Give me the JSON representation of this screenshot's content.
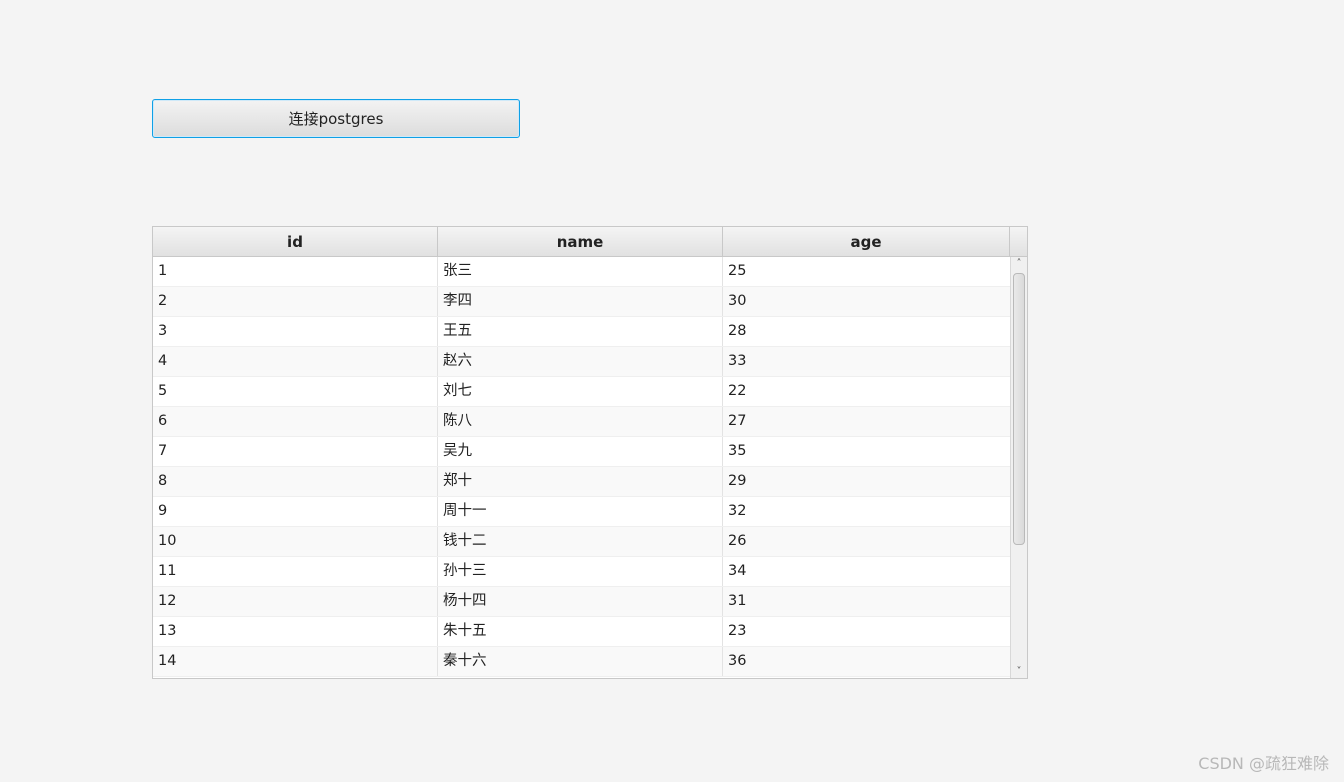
{
  "toolbar": {
    "connect_label": "连接postgres"
  },
  "table": {
    "columns": [
      "id",
      "name",
      "age"
    ],
    "rows": [
      [
        "1",
        "张三",
        "25"
      ],
      [
        "2",
        "李四",
        "30"
      ],
      [
        "3",
        "王五",
        "28"
      ],
      [
        "4",
        "赵六",
        "33"
      ],
      [
        "5",
        "刘七",
        "22"
      ],
      [
        "6",
        "陈八",
        "27"
      ],
      [
        "7",
        "吴九",
        "35"
      ],
      [
        "8",
        "郑十",
        "29"
      ],
      [
        "9",
        "周十一",
        "32"
      ],
      [
        "10",
        "钱十二",
        "26"
      ],
      [
        "11",
        "孙十三",
        "34"
      ],
      [
        "12",
        "杨十四",
        "31"
      ],
      [
        "13",
        "朱十五",
        "23"
      ],
      [
        "14",
        "秦十六",
        "36"
      ]
    ]
  },
  "scrollbar": {
    "up_icon": "chevron-up-icon",
    "down_icon": "chevron-down-icon"
  },
  "watermark": "CSDN @疏狂难除",
  "colors": {
    "focus_border": "#0fa0e6",
    "background": "#f4f4f4"
  }
}
